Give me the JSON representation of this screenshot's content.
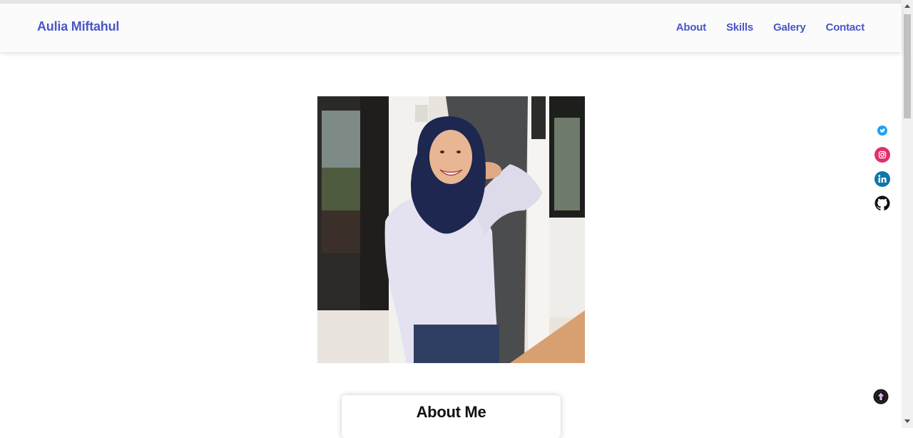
{
  "header": {
    "brand": "Aulia Miftahul",
    "nav": [
      "About",
      "Skills",
      "Galery",
      "Contact"
    ]
  },
  "hero": {
    "photo": "profile-photo"
  },
  "about": {
    "title": "About Me"
  },
  "social": [
    {
      "icon": "twitter-icon",
      "color": "#1da1f2"
    },
    {
      "icon": "instagram-icon",
      "color": "#e1306c"
    },
    {
      "icon": "linkedin-icon",
      "color": "#0e76a8"
    },
    {
      "icon": "github-icon",
      "color": "#111111"
    }
  ],
  "colors": {
    "accent": "#4a55c7",
    "navbar_bg": "#fbfbfb"
  }
}
